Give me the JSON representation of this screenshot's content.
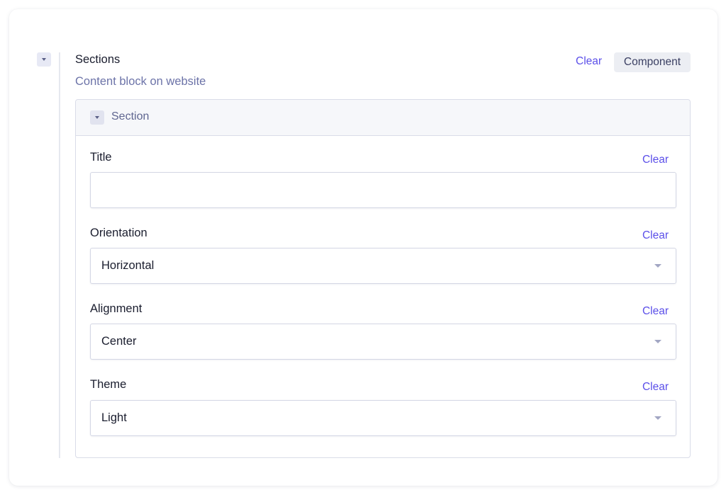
{
  "component": {
    "title": "Sections",
    "description": "Content block on website",
    "clear_label": "Clear",
    "badge_label": "Component"
  },
  "section": {
    "header_label": "Section",
    "fields": [
      {
        "label": "Title",
        "clear_label": "Clear",
        "type": "text",
        "value": ""
      },
      {
        "label": "Orientation",
        "clear_label": "Clear",
        "type": "select",
        "value": "Horizontal"
      },
      {
        "label": "Alignment",
        "clear_label": "Clear",
        "type": "select",
        "value": "Center"
      },
      {
        "label": "Theme",
        "clear_label": "Clear",
        "type": "select",
        "value": "Light"
      }
    ]
  },
  "icons": {
    "collapse": "chevron-down-icon",
    "select": "chevron-down-icon"
  },
  "colors": {
    "accent": "#5b4fe9",
    "description": "#6c73a8",
    "border": "#d9dce8",
    "header_bg": "#f6f7fa"
  }
}
